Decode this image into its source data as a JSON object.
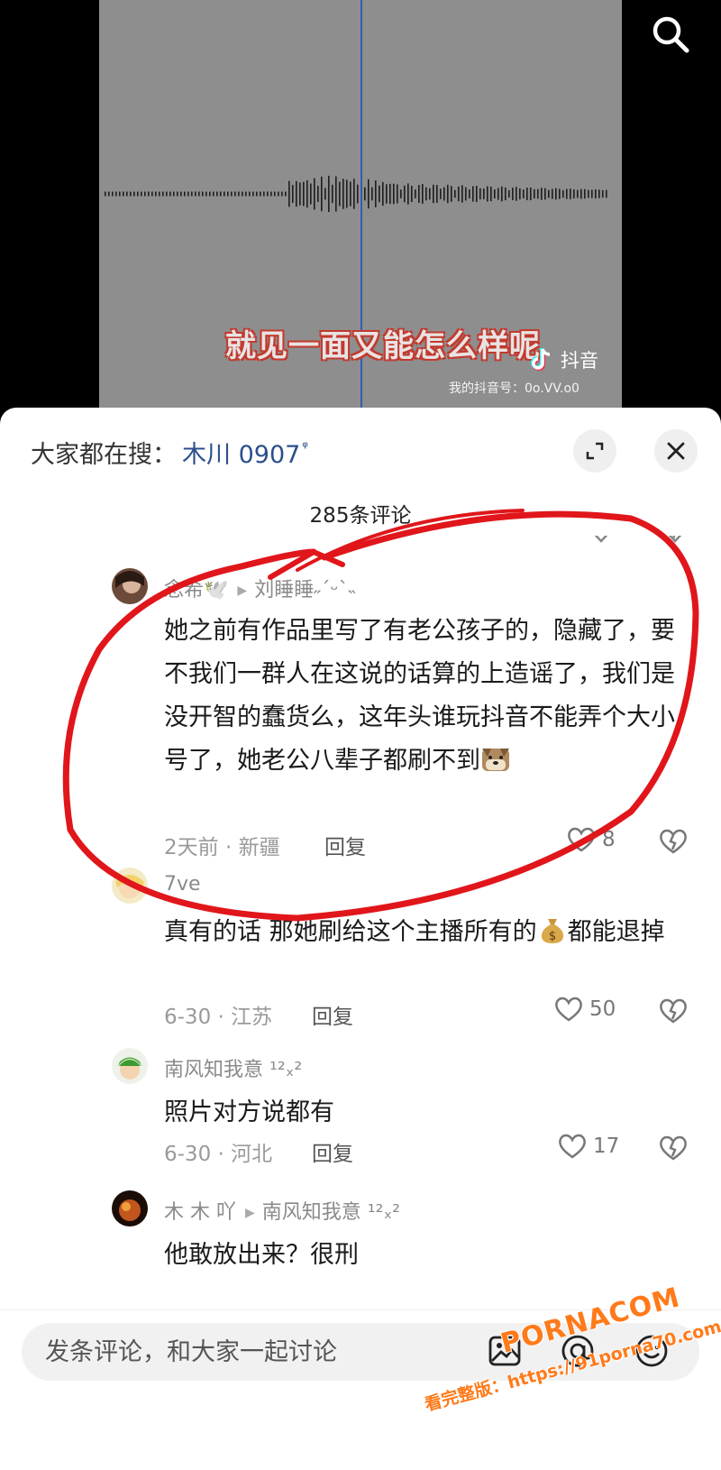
{
  "video": {
    "subtitle": "就见一面又能怎么样呢",
    "brand": "抖音",
    "douyin_id": "我的抖音号：0o.VV.o0"
  },
  "sheet": {
    "hot_search_label": "大家都在搜：",
    "hot_search_term": "木川 0907",
    "hot_search_icon": "search-small-icon",
    "comment_count": "285条评论"
  },
  "comments": [
    {
      "username": "念希🕊️",
      "reply_to": "刘睡睡˶ˊᵕˋ˵",
      "text": "她之前有作品里写了有老公孩子的，隐藏了，要不我们一群人在这说的话算的上造谣了，我们是没开智的蠢货么，这年头谁玩抖音不能弄个大小号了，她老公八辈子都刷不到",
      "emoji": "dog-face-emoji",
      "time_location": "2天前 · 新疆",
      "reply_label": "回复",
      "likes": "8"
    },
    {
      "username": "7ve",
      "reply_to": "",
      "text_before": "真有的话 那她刷给这个主播所有的",
      "emoji": "money-bag-emoji",
      "text_after": "都能退掉",
      "time_location": "6-30 · 江苏",
      "reply_label": "回复",
      "likes": "50"
    },
    {
      "username": "南风知我意 ¹²ₓ²",
      "reply_to": "",
      "text": "照片对方说都有",
      "time_location": "6-30 · 河北",
      "reply_label": "回复",
      "likes": "17"
    },
    {
      "username": "木 木 吖",
      "reply_to": "南风知我意 ¹²ₓ²",
      "text": "他敢放出来？很刑"
    }
  ],
  "input": {
    "placeholder": "发条评论，和大家一起讨论"
  },
  "watermark": {
    "brand": "PORNACOM",
    "url": "看完整版：https://91porna70.com"
  },
  "colors": {
    "annotation": "#e0161b",
    "link": "#2b4f8c",
    "watermark": "#ff7a1a"
  }
}
